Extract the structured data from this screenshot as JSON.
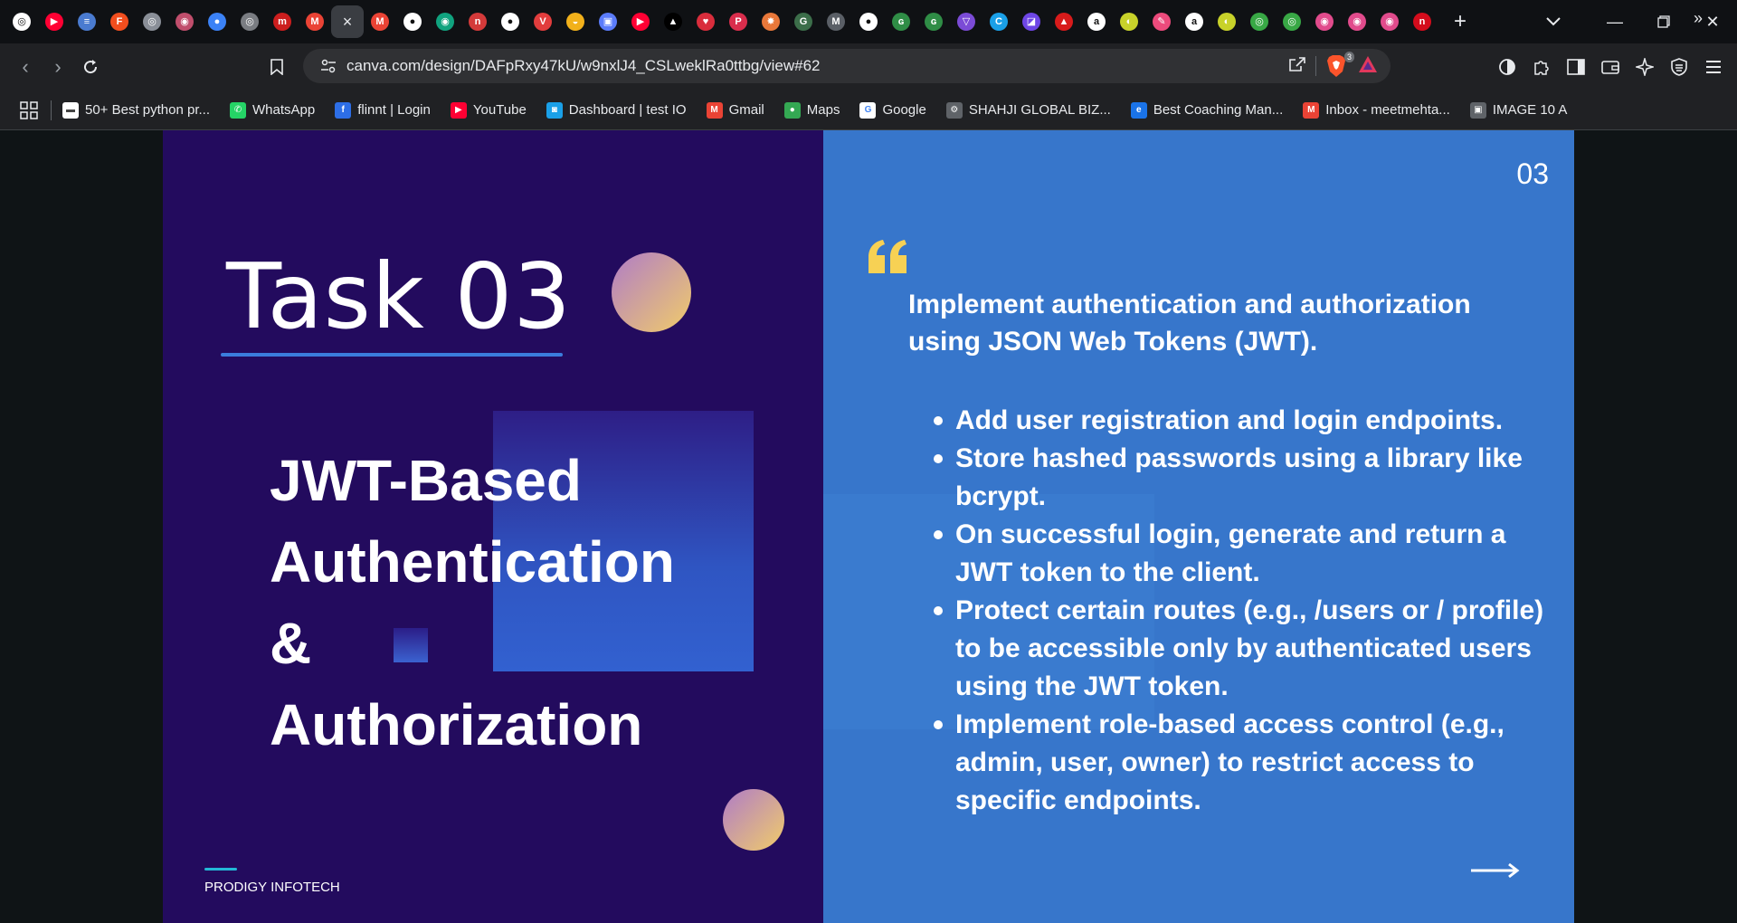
{
  "browser": {
    "tabs": [
      {
        "name": "tab-chatgpt",
        "color": "#ffffff",
        "glyph": "◎",
        "text_color": "#111"
      },
      {
        "name": "tab-youtube",
        "color": "#ff0033",
        "glyph": "▶"
      },
      {
        "name": "tab-site-1",
        "color": "#4a7bd0",
        "glyph": "≡"
      },
      {
        "name": "tab-figma",
        "color": "#f24e1e",
        "glyph": "F"
      },
      {
        "name": "tab-site-2",
        "color": "#8a8f98",
        "glyph": "◎"
      },
      {
        "name": "tab-site-3",
        "color": "#c04e6c",
        "glyph": "◉"
      },
      {
        "name": "tab-site-4",
        "color": "#3b82f6",
        "glyph": "●"
      },
      {
        "name": "tab-site-5",
        "color": "#7a7d82",
        "glyph": "◎"
      },
      {
        "name": "tab-site-6",
        "color": "#cc1e1e",
        "glyph": "m"
      },
      {
        "name": "tab-gmail-1",
        "color": "#ea4335",
        "glyph": "M"
      },
      {
        "name": "tab-canva-active",
        "color": "",
        "glyph": "×",
        "active": true
      },
      {
        "name": "tab-gmail-2",
        "color": "#ea4335",
        "glyph": "M"
      },
      {
        "name": "tab-github-1",
        "color": "#ffffff",
        "glyph": "●",
        "text_color": "#111"
      },
      {
        "name": "tab-site-7",
        "color": "#10a37f",
        "glyph": "◉"
      },
      {
        "name": "tab-site-8",
        "color": "#d43a3a",
        "glyph": "n"
      },
      {
        "name": "tab-github-2",
        "color": "#ffffff",
        "glyph": "●",
        "text_color": "#111"
      },
      {
        "name": "tab-site-9",
        "color": "#e23d3d",
        "glyph": "V"
      },
      {
        "name": "tab-site-10",
        "color": "#f2b11b",
        "glyph": "◒"
      },
      {
        "name": "tab-site-11",
        "color": "#5b7cfa",
        "glyph": "▣"
      },
      {
        "name": "tab-youtube-2",
        "color": "#ff0033",
        "glyph": "▶"
      },
      {
        "name": "tab-site-12",
        "color": "#000000",
        "glyph": "▲"
      },
      {
        "name": "tab-site-13",
        "color": "#d92d3c",
        "glyph": "♥"
      },
      {
        "name": "tab-site-14",
        "color": "#d92d4c",
        "glyph": "P"
      },
      {
        "name": "tab-site-15",
        "color": "#e8783a",
        "glyph": "✸"
      },
      {
        "name": "tab-site-16",
        "color": "#3c6e4a",
        "glyph": "G"
      },
      {
        "name": "tab-site-17",
        "color": "#5a5f66",
        "glyph": "M"
      },
      {
        "name": "tab-github-3",
        "color": "#ffffff",
        "glyph": "●",
        "text_color": "#111"
      },
      {
        "name": "tab-gfg-1",
        "color": "#2f8d46",
        "glyph": "ɢ"
      },
      {
        "name": "tab-gfg-2",
        "color": "#2f8d46",
        "glyph": "ɢ"
      },
      {
        "name": "tab-site-18",
        "color": "#7b4bd6",
        "glyph": "▽"
      },
      {
        "name": "tab-canva",
        "color": "#1aa0e8",
        "glyph": "C"
      },
      {
        "name": "tab-site-19",
        "color": "#6e46e6",
        "glyph": "◪"
      },
      {
        "name": "tab-site-20",
        "color": "#d81b1b",
        "glyph": "▲"
      },
      {
        "name": "tab-amazon-1",
        "color": "#ffffff",
        "glyph": "a",
        "text_color": "#111"
      },
      {
        "name": "tab-site-21",
        "color": "#c8d22a",
        "glyph": "◐"
      },
      {
        "name": "tab-site-22",
        "color": "#ec4b7c",
        "glyph": "✎"
      },
      {
        "name": "tab-amazon-2",
        "color": "#ffffff",
        "glyph": "a",
        "text_color": "#111"
      },
      {
        "name": "tab-site-23",
        "color": "#c8d22a",
        "glyph": "◐"
      },
      {
        "name": "tab-site-24",
        "color": "#38a845",
        "glyph": "◎"
      },
      {
        "name": "tab-site-25",
        "color": "#38a845",
        "glyph": "◎"
      },
      {
        "name": "tab-site-26",
        "color": "#e14b8c",
        "glyph": "◉"
      },
      {
        "name": "tab-site-27",
        "color": "#e14b8c",
        "glyph": "◉"
      },
      {
        "name": "tab-site-28",
        "color": "#e14b8c",
        "glyph": "◉"
      },
      {
        "name": "tab-netflix",
        "color": "#d40c1c",
        "glyph": "n"
      }
    ],
    "url": "canva.com/design/DAFpRxy47kU/w9nxlJ4_CSLweklRa0ttbg/view#62",
    "brave_shield_count": "3"
  },
  "bookmarks": [
    {
      "label": "50+ Best python pr...",
      "icon_color": "#ffffff",
      "glyph": "▬",
      "icon_text": "#444"
    },
    {
      "label": "WhatsApp",
      "icon_color": "#25d366",
      "glyph": "✆"
    },
    {
      "label": "flinnt | Login",
      "icon_color": "#2d6ee6",
      "glyph": "f"
    },
    {
      "label": "YouTube",
      "icon_color": "#ff0033",
      "glyph": "▶"
    },
    {
      "label": "Dashboard | test IO",
      "icon_color": "#1aa0e8",
      "glyph": "◙"
    },
    {
      "label": "Gmail",
      "icon_color": "#ea4335",
      "glyph": "M"
    },
    {
      "label": "Maps",
      "icon_color": "#34a853",
      "glyph": "●"
    },
    {
      "label": "Google",
      "icon_color": "#ffffff",
      "glyph": "G",
      "icon_text": "#4285f4"
    },
    {
      "label": "SHAHJI GLOBAL BIZ...",
      "icon_color": "#5f6368",
      "glyph": "⚙"
    },
    {
      "label": "Best Coaching Man...",
      "icon_color": "#1a73e8",
      "glyph": "e"
    },
    {
      "label": "Inbox - meetmehta...",
      "icon_color": "#ea4335",
      "glyph": "M"
    },
    {
      "label": "IMAGE 10 A",
      "icon_color": "#5f6368",
      "glyph": "▣"
    }
  ],
  "slide": {
    "task_title": "Task 03",
    "heading_lines": [
      "JWT-Based",
      "Authentication",
      "&",
      "Authorization"
    ],
    "footer": "PRODIGY INFOTECH",
    "page_number": "03",
    "intro": "Implement authentication and authorization using JSON Web Tokens (JWT).",
    "bullets": [
      "Add user registration and login endpoints.",
      "Store hashed passwords using a library like bcrypt.",
      "On successful login, generate and return a JWT token to the client.",
      "Protect certain routes (e.g., /users or / profile) to be accessible only by authenticated users using the JWT token.",
      "Implement role-based access control (e.g., admin, user, owner) to restrict access to specific endpoints."
    ],
    "colors": {
      "left_panel": "#230b5e",
      "right_panel": "#3776cb",
      "accent_underline": "#3b7ddd",
      "quote_mark": "#f7d154",
      "footer_line": "#23b8d6"
    }
  }
}
